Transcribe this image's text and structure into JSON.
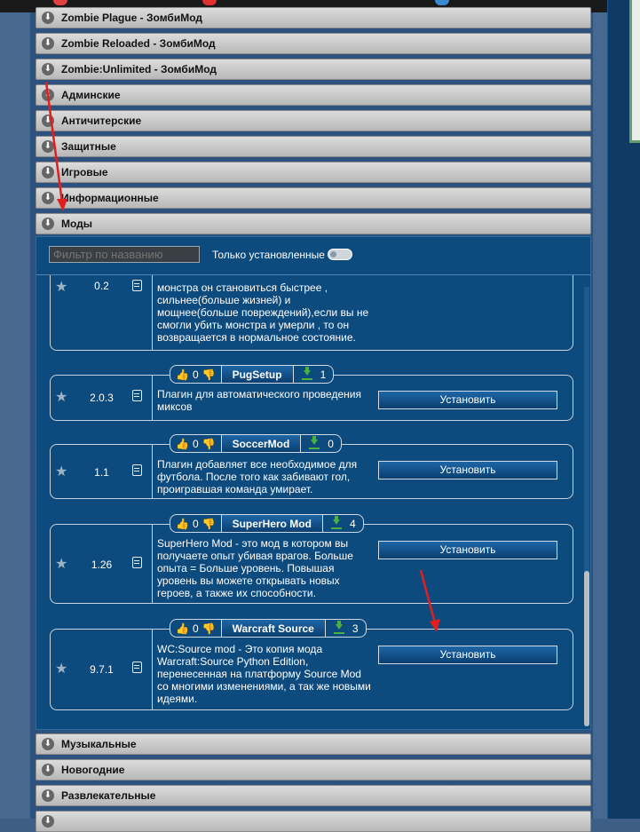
{
  "categories_top": [
    {
      "label": "Zombie Plague - ЗомбиМод"
    },
    {
      "label": "Zombie Reloaded - ЗомбиМод"
    },
    {
      "label": "Zombie:Unlimited - ЗомбиМод"
    },
    {
      "label": "Админские"
    },
    {
      "label": "Античитерские"
    },
    {
      "label": "Защитные"
    },
    {
      "label": "Игровые"
    },
    {
      "label": "Информационные"
    },
    {
      "label": "Моды"
    }
  ],
  "categories_bottom": [
    {
      "label": "Музыкальные"
    },
    {
      "label": "Новогодние"
    },
    {
      "label": "Развлекательные"
    }
  ],
  "filter": {
    "placeholder": "Фильтр по названию",
    "only_installed_label": "Только установленные"
  },
  "mods": [
    {
      "version": "0.2",
      "description": "монстра он становиться быстрее , сильнее(больше жизней) и мощнее(больше повреждений),если вы не смогли убить монстра и умерли , то он возвращается в нормальное состояние."
    },
    {
      "name": "PugSetup",
      "likes": "0",
      "downloads": "1",
      "version": "2.0.3",
      "description": "Плагин для автоматического проведения миксов",
      "install_label": "Установить"
    },
    {
      "name": "SoccerMod",
      "likes": "0",
      "downloads": "0",
      "version": "1.1",
      "description": "Плагин добавляет все необходимое для футбола. После того как забивают гол, проигравшая команда умирает.",
      "install_label": "Установить"
    },
    {
      "name": "SuperHero Mod",
      "likes": "0",
      "downloads": "4",
      "version": "1.26",
      "description": "SuperHero Mod - это мод в котором вы получаете опыт убивая врагов. Больше опыта = Больше уровень. Повышая уровень вы можете открывать новых героев, а также их способности.",
      "install_label": "Установить"
    },
    {
      "name": "Warcraft Source",
      "likes": "0",
      "downloads": "3",
      "version": "9.7.1",
      "description": "WC:Source mod - Это копия мода Warcraft:Source Python Edition, перенесенная на платформу Source Mod со многими изменениями, а так же новыми идеями.",
      "install_label": "Установить"
    }
  ],
  "colors": {
    "accent": "#0d4a7e",
    "annotation": "#e02020",
    "download": "#4ab040"
  }
}
